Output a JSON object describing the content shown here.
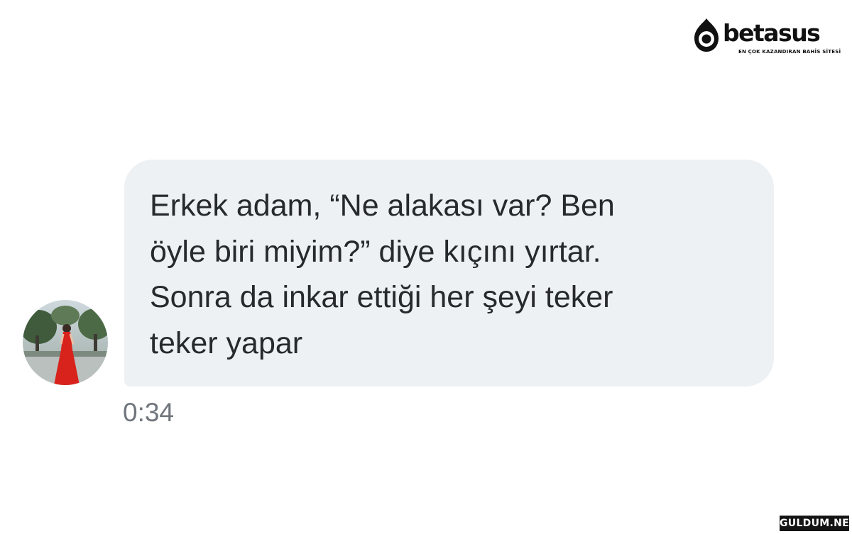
{
  "brand": {
    "name": "betasus",
    "tagline": "EN ÇOK KAZANDIRAN BAHİS SİTESİ"
  },
  "message": {
    "text": "Erkek adam, “Ne alakası var? Ben\nöyle biri miyim?” diye kıçını yırtar.\nSonra da inkar ettiği her şeyi teker\nteker yapar",
    "timestamp": "0:34",
    "bubble_color": "#eef1f4"
  },
  "avatar": {
    "icon": "profile-photo"
  },
  "watermark": {
    "text": "GULDUM.NET"
  }
}
